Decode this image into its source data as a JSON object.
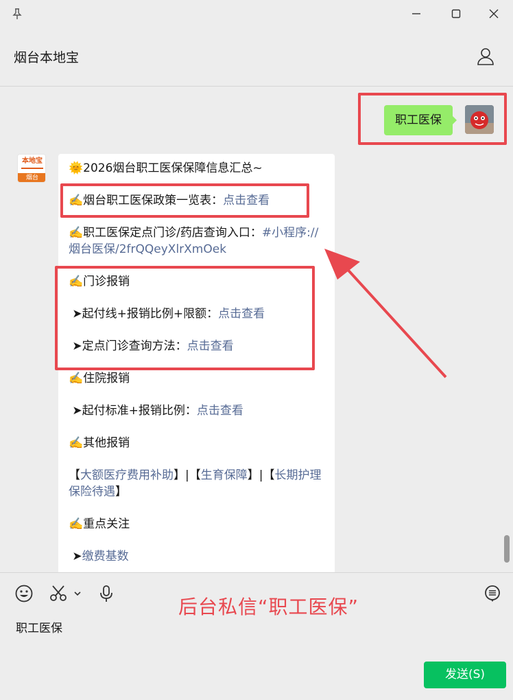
{
  "window": {
    "pin_icon": "pin-icon",
    "minimize_icon": "minimize-icon",
    "maximize_icon": "maximize-icon",
    "close_icon": "close-icon"
  },
  "header": {
    "title": "烟台本地宝",
    "profile_icon": "user-profile-icon"
  },
  "messages": {
    "outgoing": {
      "text": "职工医保"
    },
    "incoming": {
      "avatar_text_top": "本地宝",
      "avatar_text_bottom": "烟台",
      "line1": "🌞2026烟台职工医保保障信息汇总~",
      "line2_prefix": "✍️烟台职工医保政策一览表：",
      "line2_link": "点击查看",
      "line3_prefix": "✍️职工医保定点门诊/药店查询入口：",
      "line3_link": "#小程序://烟台医保/2frQQeyXlrXmOek",
      "line4": "✍️门诊报销",
      "line5_prefix": "➤起付线+报销比例+限额：",
      "line5_link": "点击查看",
      "line6_prefix": "➤定点门诊查询方法：",
      "line6_link": "点击查看",
      "line7": "✍️住院报销",
      "line8_prefix": "➤起付标准+报销比例：",
      "line8_link": "点击查看",
      "line9": "✍️其他报销",
      "line10_b1": "【",
      "line10_link1": "大额医疗费用补助",
      "line10_b2": "】|【",
      "line10_link2": "生育保障",
      "line10_b3": "】|【",
      "line10_link3": "长期护理保险待遇",
      "line10_b4": "】",
      "line11": "✍️重点关注",
      "line12_prefix": "➤",
      "line12_link": "缴费基数"
    }
  },
  "toolbar": {
    "emoji_icon": "emoji-icon",
    "scissors_icon": "scissors-icon",
    "dropdown_icon": "chevron-down-icon",
    "mic_icon": "microphone-icon",
    "history_icon": "chat-history-icon"
  },
  "promo": {
    "text": "后台私信“职工医保”"
  },
  "input": {
    "value": "职工医保"
  },
  "send_button": {
    "label": "发送(S)"
  },
  "colors": {
    "accent_red": "#e8484f",
    "send_green": "#07c160",
    "bubble_green": "#95ec69",
    "link_blue": "#576b95"
  }
}
